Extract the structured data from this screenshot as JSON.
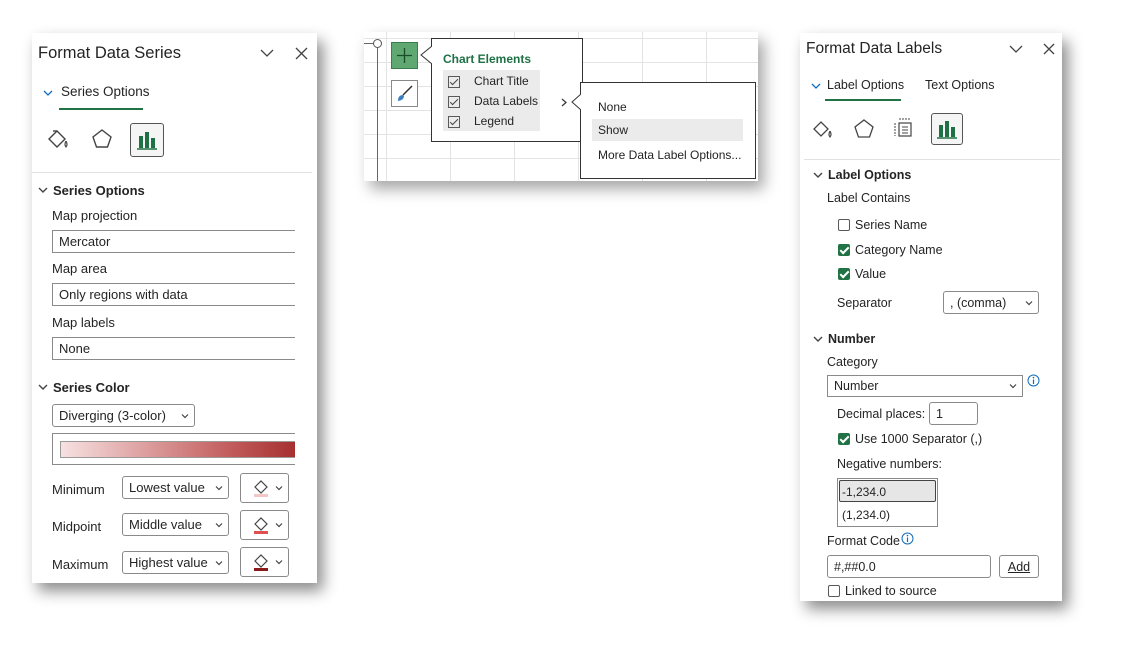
{
  "left_panel": {
    "title": "Format Data Series",
    "tab": "Series Options",
    "icons": [
      "fill-line-icon",
      "effects-icon",
      "series-options-icon"
    ],
    "series_options": {
      "heading": "Series Options",
      "map_projection_label": "Map projection",
      "map_projection_value": "Mercator",
      "map_area_label": "Map area",
      "map_area_value": "Only regions with data",
      "map_labels_label": "Map labels",
      "map_labels_value": "None"
    },
    "series_color": {
      "heading": "Series Color",
      "scheme": "Diverging (3-color)",
      "minimum_label": "Minimum",
      "minimum_value": "Lowest value",
      "midpoint_label": "Midpoint",
      "midpoint_value": "Middle value",
      "maximum_label": "Maximum",
      "maximum_value": "Highest value",
      "gradient_start": "#f6dede",
      "gradient_end": "#a63030",
      "min_color": "#f4c6c6",
      "mid_color": "#e05050",
      "max_color": "#8b1a1a"
    }
  },
  "chart_popup": {
    "title": "Chart Elements",
    "items": [
      {
        "label": "Chart Title",
        "checked": true
      },
      {
        "label": "Data Labels",
        "checked": true
      },
      {
        "label": "Legend",
        "checked": true
      }
    ],
    "submenu": [
      "None",
      "Show",
      "More Data Label Options..."
    ],
    "highlighted": "Show"
  },
  "right_panel": {
    "title": "Format Data Labels",
    "tabs": [
      "Label Options",
      "Text Options"
    ],
    "label_options": {
      "heading": "Label Options",
      "label_contains": "Label Contains",
      "series_name": "Series Name",
      "category_name": "Category Name",
      "value": "Value",
      "separator_label": "Separator",
      "separator_value": ", (comma)"
    },
    "number": {
      "heading": "Number",
      "category_label": "Category",
      "category_value": "Number",
      "decimal_label": "Decimal places:",
      "decimal_value": "1",
      "use_1000": "Use 1000 Separator (,)",
      "negative_label": "Negative numbers:",
      "negative_options": [
        "-1,234.0",
        "(1,234.0)"
      ],
      "format_code_label": "Format Code",
      "format_code_value": "#,##0.0",
      "add_label": "Add",
      "linked_label": "Linked to source"
    }
  },
  "colors": {
    "accent": "#217346",
    "chart_green": "#1e7145",
    "info_blue": "#0f6cbd"
  }
}
